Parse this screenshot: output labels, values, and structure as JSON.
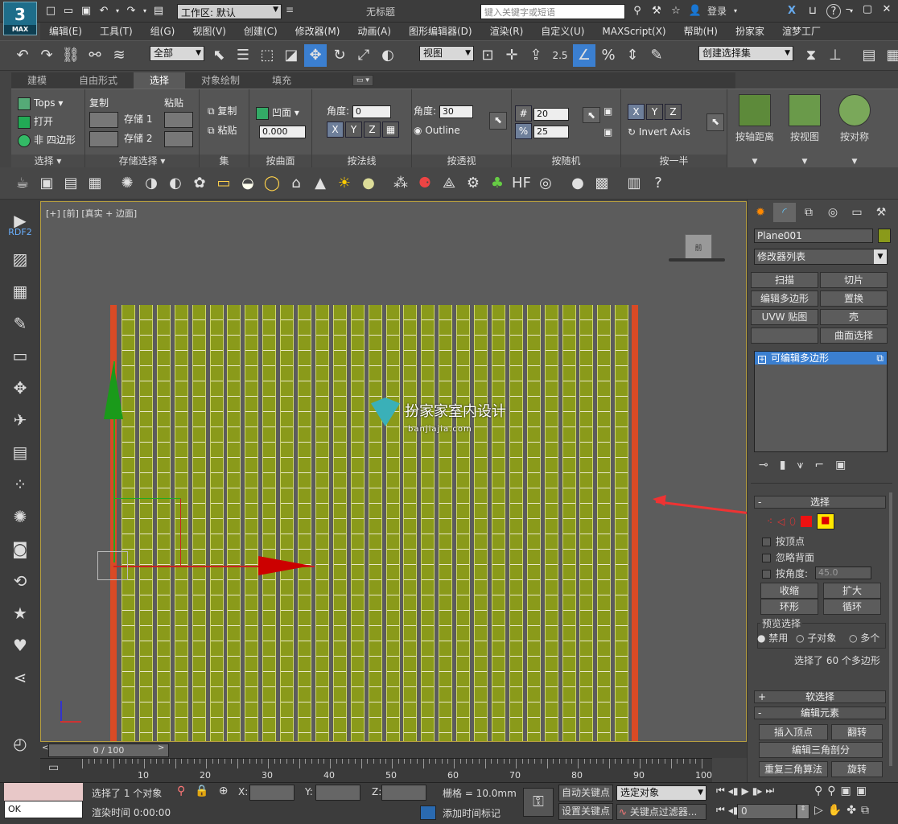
{
  "titlebar": {
    "logo": "3",
    "logo_sub": "MAX",
    "workspace": "工作区: 默认",
    "title": "无标题",
    "search_placeholder": "键入关键字或短语",
    "login": "登录"
  },
  "menus": [
    "编辑(E)",
    "工具(T)",
    "组(G)",
    "视图(V)",
    "创建(C)",
    "修改器(M)",
    "动画(A)",
    "图形编辑器(D)",
    "渲染(R)",
    "自定义(U)",
    "MAXScript(X)",
    "帮助(H)",
    "扮家家",
    "渲梦工厂"
  ],
  "toolbar1": {
    "filter": "全部",
    "refcoord": "视图",
    "snap25": "2.5",
    "named_sel": "创建选择集"
  },
  "ribbon": {
    "tabs": [
      "建模",
      "自由形式",
      "选择",
      "对象绘制",
      "填充"
    ],
    "active_tab": "选择",
    "groups": {
      "select": {
        "label": "选择",
        "tops": "Tops",
        "open": "打开",
        "nonquad": "非 四边形"
      },
      "stored": {
        "label": "存储选择",
        "copy": "复制",
        "paste": "粘贴",
        "store1": "存储 1",
        "store2": "存储 2"
      },
      "sets": {
        "label": "集",
        "copy": "复制",
        "paste": "粘贴"
      },
      "concave": {
        "label": "按曲面",
        "concave": "凹面",
        "value": "0.000"
      },
      "normal": {
        "label": "按法线",
        "angle_label": "角度:",
        "angle": "0"
      },
      "perspective": {
        "label": "按透视",
        "angle_label": "角度:",
        "angle": "30",
        "outline": "Outline"
      },
      "random": {
        "label": "按随机",
        "v1": "20",
        "v2": "25"
      },
      "half": {
        "label": "按一半",
        "invert": "Invert Axis"
      },
      "big": [
        "按轴距离",
        "按视图",
        "按对称"
      ],
      "xyz": [
        "X",
        "Y",
        "Z"
      ]
    }
  },
  "leftbar": {
    "rdf": "RDF2"
  },
  "viewport": {
    "label": "[+] [前] [真实 + 边面]",
    "watermark": "扮家家室内设计",
    "watermark_url": "banjiajia.com",
    "strip_count": 29
  },
  "rightpanel": {
    "object_name": "Plane001",
    "modifier_list": "修改器列表",
    "buttons": [
      "扫描",
      "切片",
      "编辑多边形",
      "置换",
      "UVW 贴图",
      "壳",
      "",
      "曲面选择"
    ],
    "stack_item": "可编辑多边形",
    "selection_rollout": "选择",
    "by_vertex": "按顶点",
    "ignore_back": "忽略背面",
    "by_angle": "按角度:",
    "angle_value": "45.0",
    "shrink": "收缩",
    "grow": "扩大",
    "ring": "环形",
    "loop": "循环",
    "preview": "预览选择",
    "disable": "禁用",
    "subobject": "子对象",
    "multi": "多个",
    "status": "选择了 60 个多边形",
    "soft_sel": "软选择",
    "edit_elements": "编辑元素",
    "insert_vertex": "插入顶点",
    "flip": "翻转",
    "edit_tri": "编辑三角剖分",
    "retri": "重复三角算法",
    "rotate": "旋转"
  },
  "timeline": {
    "slider": "0 / 100",
    "ticks": [
      "0",
      "10",
      "20",
      "30",
      "40",
      "50",
      "60",
      "70",
      "80",
      "90",
      "100"
    ]
  },
  "status": {
    "ok": "OK",
    "selected": "选择了 1 个对象",
    "render_time": "渲染时间 0:00:00",
    "x_label": "X:",
    "y_label": "Y:",
    "z_label": "Z:",
    "grid": "栅格 = 10.0mm",
    "add_time_tag": "添加时间标记",
    "auto_key": "自动关键点",
    "set_key": "设置关键点",
    "sel_obj": "选定对象",
    "key_filter": "关键点过滤器...",
    "frame": "0"
  }
}
